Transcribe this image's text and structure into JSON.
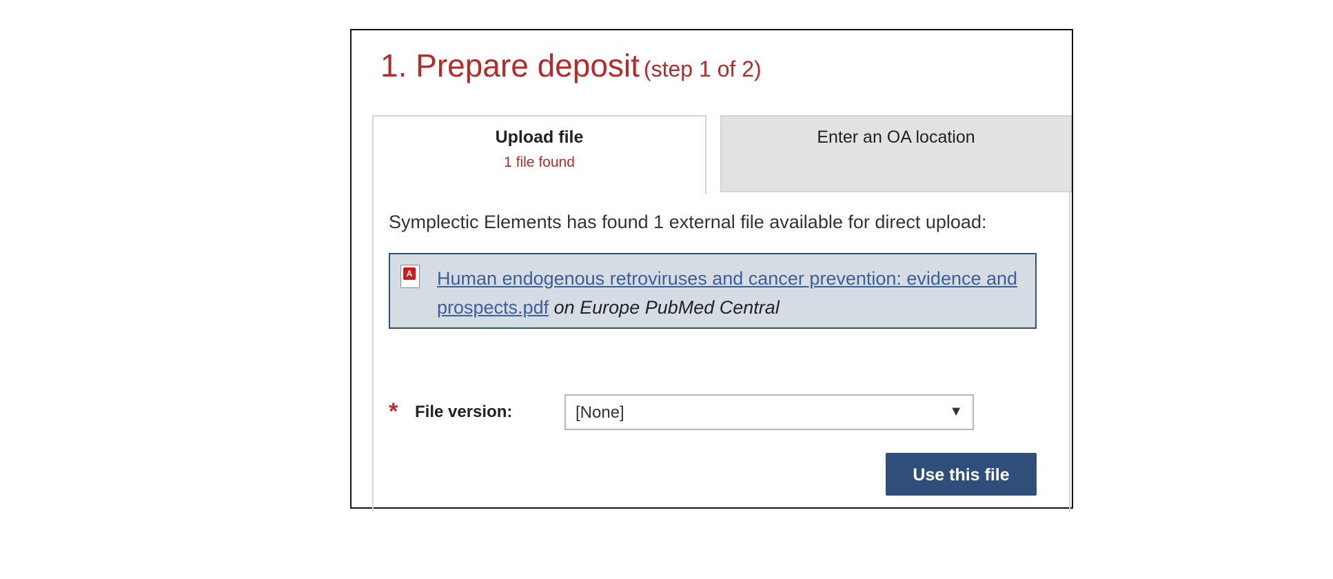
{
  "header": {
    "title": "1. Prepare deposit",
    "step": "(step 1 of 2)"
  },
  "tabs": [
    {
      "label": "Upload file",
      "count": "1 file found",
      "active": true
    },
    {
      "label": "Enter an OA location",
      "active": false
    }
  ],
  "upload": {
    "found_text": "Symplectic Elements has found 1 external file available for direct upload:",
    "file": {
      "icon": "pdf-file-icon",
      "name": "Human endogenous retroviruses and cancer prevention: evidence and prospects.pdf",
      "source": "on Europe PubMed Central"
    },
    "version_label": "File version:",
    "version_value": "[None]",
    "use_button": "Use this file"
  },
  "colors": {
    "accent_red": "#b52b2b",
    "primary_blue": "#2f4f7a",
    "file_box_bg": "#d6dce4",
    "inactive_tab_bg": "#e2e2e2"
  }
}
